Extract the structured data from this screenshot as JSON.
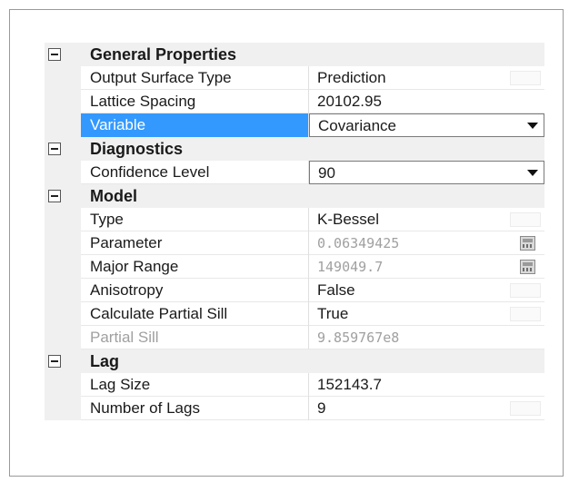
{
  "sections": [
    {
      "title": "General Properties",
      "rows": [
        {
          "name": "Output Surface Type",
          "value": "Prediction",
          "kind": "ghost"
        },
        {
          "name": "Lattice Spacing",
          "value": "20102.95",
          "kind": "text"
        },
        {
          "name": "Variable",
          "value": "Covariance",
          "kind": "dropdown",
          "selected": true
        }
      ]
    },
    {
      "title": "Diagnostics",
      "rows": [
        {
          "name": "Confidence Level",
          "value": "90",
          "kind": "dropdown"
        }
      ]
    },
    {
      "title": "Model",
      "rows": [
        {
          "name": "Type",
          "value": "K-Bessel",
          "kind": "ghost"
        },
        {
          "name": "Parameter",
          "value": "0.06349425",
          "kind": "calculator"
        },
        {
          "name": "Major Range",
          "value": "149049.7",
          "kind": "calculator"
        },
        {
          "name": "Anisotropy",
          "value": "False",
          "kind": "ghost"
        },
        {
          "name": "Calculate Partial Sill",
          "value": "True",
          "kind": "ghost"
        },
        {
          "name": "Partial Sill",
          "value": "9.859767e8",
          "kind": "disabled"
        }
      ]
    },
    {
      "title": "Lag",
      "rows": [
        {
          "name": "Lag Size",
          "value": "152143.7",
          "kind": "text"
        },
        {
          "name": "Number of Lags",
          "value": "9",
          "kind": "ghost"
        }
      ]
    }
  ],
  "colors": {
    "selection": "#3399ff",
    "category_bg": "#f0f0f0",
    "disabled_text": "#a0a0a0"
  },
  "icons": {
    "collapse": "collapse-minus-icon",
    "dropdown": "dropdown-arrow-icon",
    "calculator": "calculator-icon"
  }
}
